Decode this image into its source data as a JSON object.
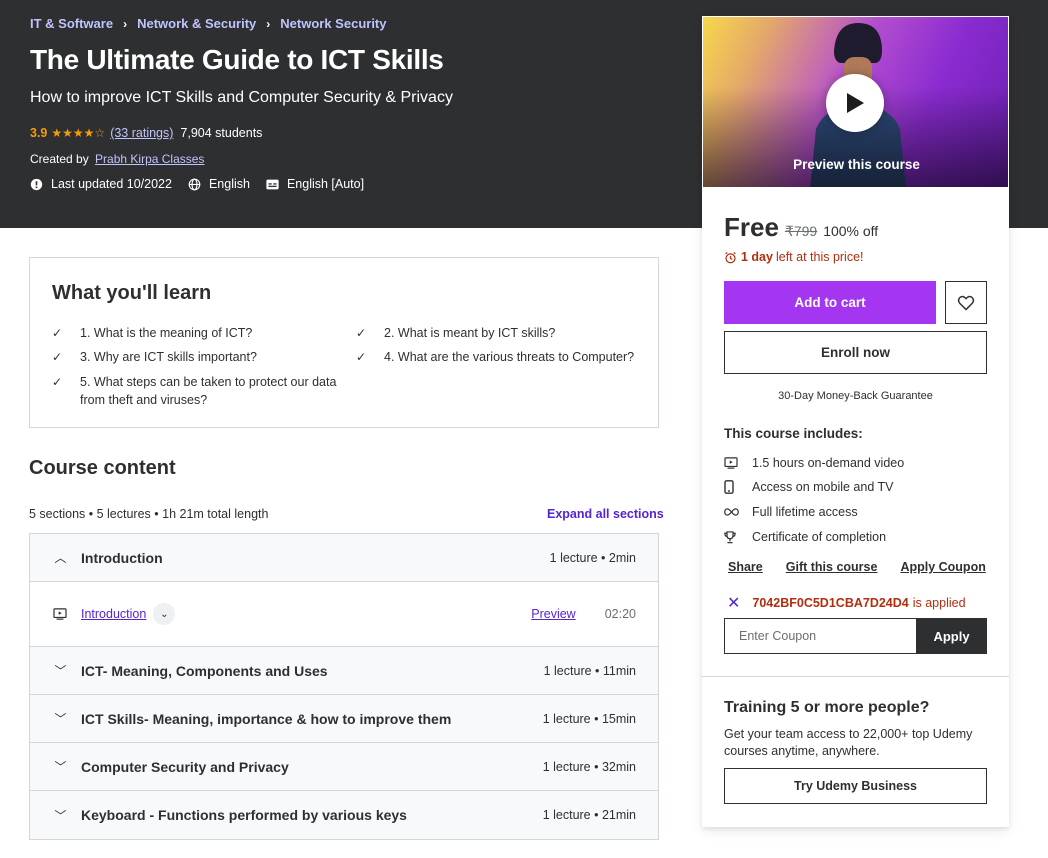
{
  "breadcrumb": [
    "IT & Software",
    "Network & Security",
    "Network Security"
  ],
  "course": {
    "title": "The Ultimate Guide to ICT Skills",
    "subtitle": "How to improve ICT Skills and Computer Security & Privacy",
    "rating": "3.9",
    "rating_value": 3.9,
    "stars": "★★★★☆",
    "ratings_count": "(33 ratings)",
    "students": "7,904 students",
    "created_by_label": "Created by",
    "instructor": "Prabh Kirpa Classes",
    "last_updated": "Last updated 10/2022",
    "language": "English",
    "captions": "English [Auto]"
  },
  "learn": {
    "title": "What you'll learn",
    "items": [
      "1. What is the meaning of ICT?",
      "2. What is meant by ICT skills?",
      "3. Why are ICT skills important?",
      "4. What are the various threats to Computer?",
      "5. What steps can be taken to protect our data from theft and viruses?"
    ]
  },
  "content": {
    "title": "Course content",
    "summary": "5 sections • 5 lectures • 1h 21m total length",
    "expand_label": "Expand all sections",
    "sections": [
      {
        "title": "Introduction",
        "info": "1 lecture • 2min",
        "expanded": true
      },
      {
        "title": "ICT- Meaning, Components and Uses",
        "info": "1 lecture • 11min",
        "expanded": false
      },
      {
        "title": "ICT Skills- Meaning, importance & how to improve them",
        "info": "1 lecture • 15min",
        "expanded": false
      },
      {
        "title": "Computer Security and Privacy",
        "info": "1 lecture • 32min",
        "expanded": false
      },
      {
        "title": "Keyboard - Functions performed by various keys",
        "info": "1 lecture • 21min",
        "expanded": false
      }
    ],
    "lecture": {
      "title": "Introduction",
      "preview": "Preview",
      "duration": "02:20"
    }
  },
  "sidebar": {
    "preview_label": "Preview this course",
    "price": "Free",
    "original_price": "₹799",
    "discount": "100% off",
    "timer_bold": "1 day",
    "timer_rest": "left at this price!",
    "add_to_cart": "Add to cart",
    "enroll": "Enroll now",
    "guarantee": "30-Day Money-Back Guarantee",
    "includes_title": "This course includes:",
    "includes": [
      {
        "icon": "video-icon",
        "text": "1.5 hours on-demand video"
      },
      {
        "icon": "mobile-icon",
        "text": "Access on mobile and TV"
      },
      {
        "icon": "infinity-icon",
        "text": "Full lifetime access"
      },
      {
        "icon": "trophy-icon",
        "text": "Certificate of completion"
      }
    ],
    "share": "Share",
    "gift": "Gift this course",
    "apply_coupon": "Apply Coupon",
    "coupon_code": "7042BF0C5D1CBA7D24D4",
    "coupon_applied": "is applied",
    "coupon_placeholder": "Enter Coupon",
    "apply": "Apply",
    "biz_title": "Training 5 or more people?",
    "biz_text": "Get your team access to 22,000+ top Udemy courses anytime, anywhere.",
    "biz_button": "Try Udemy Business"
  },
  "colors": {
    "hero_bg": "#2d2f31",
    "accent_purple": "#a435f0",
    "link_purple": "#5624d0",
    "star_orange": "#f69c08",
    "alert_red": "#b32d0f"
  }
}
